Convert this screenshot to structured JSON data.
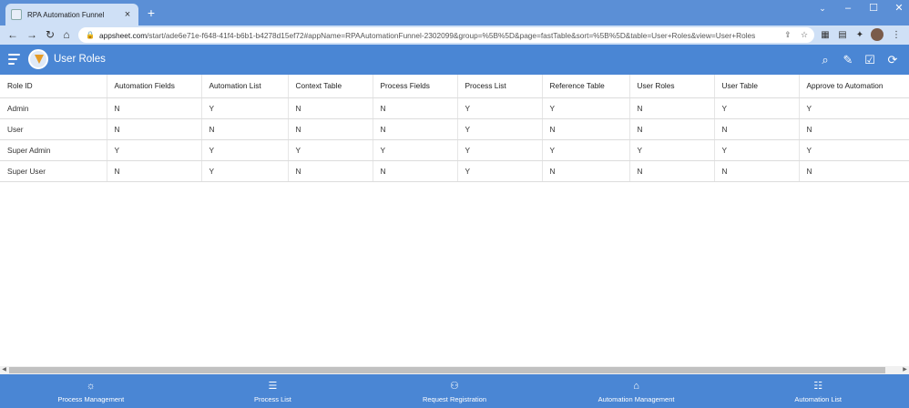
{
  "browser": {
    "tab_title": "RPA Automation Funnel",
    "url_host": "appsheet.com",
    "url_path": "/start/ade6e71e-f648-41f4-b6b1-b4278d15ef72#appName=RPAAutomationFunnel-2302099&group=%5B%5D&page=fastTable&sort=%5B%5D&table=User+Roles&view=User+Roles"
  },
  "app": {
    "page_title": "User Roles",
    "accent_color": "#4a86d4"
  },
  "table": {
    "columns": [
      "Role ID",
      "Automation Fields",
      "Automation List",
      "Context Table",
      "Process Fields",
      "Process List",
      "Reference Table",
      "User Roles",
      "User Table",
      "Approve to Automation"
    ],
    "rows": [
      [
        "Admin",
        "N",
        "Y",
        "N",
        "N",
        "Y",
        "Y",
        "N",
        "Y",
        "Y"
      ],
      [
        "User",
        "N",
        "N",
        "N",
        "N",
        "Y",
        "N",
        "N",
        "N",
        "N"
      ],
      [
        "Super Admin",
        "Y",
        "Y",
        "Y",
        "Y",
        "Y",
        "Y",
        "Y",
        "Y",
        "Y"
      ],
      [
        "Super User",
        "N",
        "Y",
        "N",
        "N",
        "Y",
        "N",
        "N",
        "N",
        "N"
      ]
    ]
  },
  "bottom_nav": [
    {
      "label": "Process Management",
      "icon": "bulb-icon"
    },
    {
      "label": "Process List",
      "icon": "list-icon"
    },
    {
      "label": "Request Registration",
      "icon": "add-person-icon"
    },
    {
      "label": "Automation Management",
      "icon": "robot-icon"
    },
    {
      "label": "Automation List",
      "icon": "checklist-icon"
    }
  ]
}
